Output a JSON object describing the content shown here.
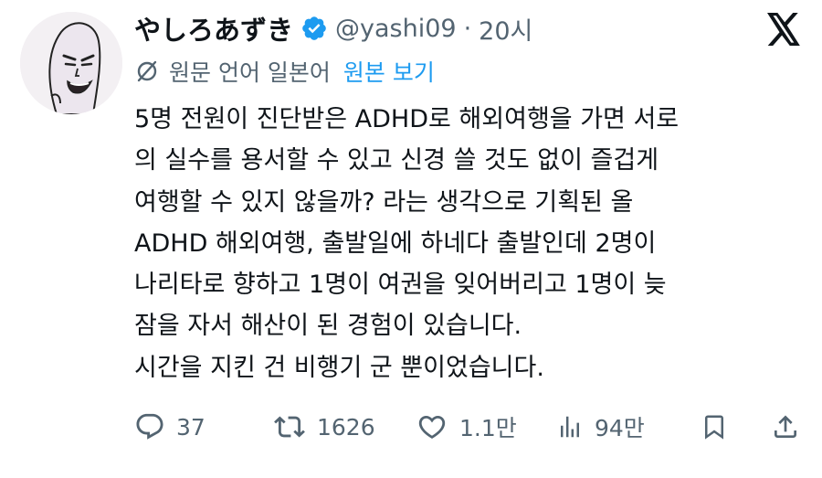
{
  "user": {
    "display_name": "やしろあずき",
    "handle": "@yashi09",
    "separator": "·",
    "time": "20시"
  },
  "translation": {
    "original_language": "원문 언어 일본어",
    "view_original_label": "원본 보기"
  },
  "tweet": {
    "lines": [
      "5명 전원이 진단받은 ADHD로 해외여행을 가면 서로",
      "의 실수를 용서할 수 있고 신경 쓸 것도 없이 즐겁게",
      "여행할 수 있지 않을까? 라는 생각으로 기획된 올",
      "ADHD 해외여행, 출발일에 하네다 출발인데 2명이",
      "나리타로 향하고 1명이 여권을 잊어버리고 1명이 늦",
      "잠을 자서 해산이 된 경험이 있습니다.",
      "시간을 지킨 건 비행기 군 뿐이었습니다."
    ]
  },
  "actions": {
    "replies": "37",
    "retweets": "1626",
    "likes": "1.1만",
    "views": "94만"
  },
  "icons": {
    "verified": "verified-badge-icon",
    "x_logo": "x-logo-icon",
    "translate": "translate-icon",
    "reply": "reply-icon",
    "retweet": "retweet-icon",
    "like": "heart-icon",
    "views": "views-chart-icon",
    "bookmark": "bookmark-icon",
    "share": "share-icon"
  },
  "colors": {
    "text_primary": "#0f1419",
    "text_secondary": "#536471",
    "accent": "#1d9bf0"
  }
}
